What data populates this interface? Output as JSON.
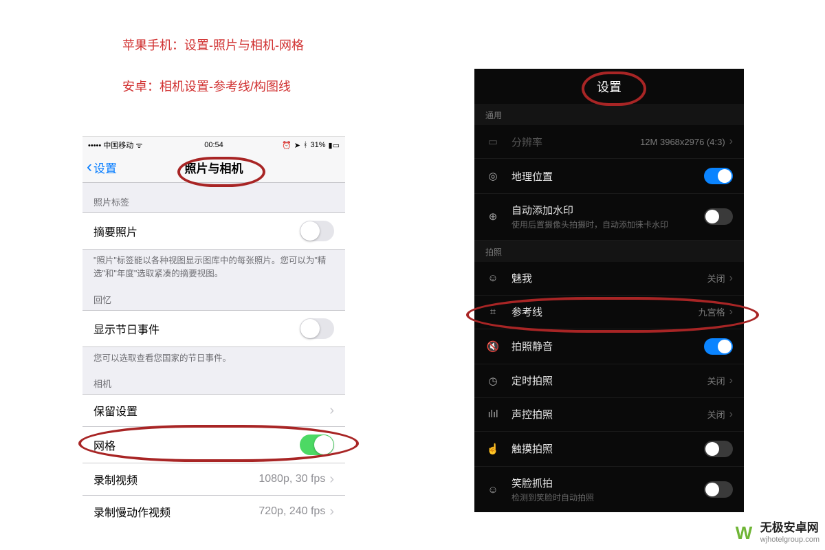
{
  "instructions": {
    "apple": "苹果手机：设置-照片与相机-网格",
    "android": "安卓：相机设置-参考线/构图线"
  },
  "ios": {
    "carrier": "中国移动",
    "time": "00:54",
    "battery": "31%",
    "back": "设置",
    "title": "照片与相机",
    "section_photos": "照片标签",
    "row_summary": "摘要照片",
    "summary_footer": "\"照片\"标签能以各种视图显示图库中的每张照片。您可以为\"精选\"和\"年度\"选取紧凑的摘要视图。",
    "section_memories": "回忆",
    "row_holiday": "显示节日事件",
    "holiday_footer": "您可以选取查看您国家的节日事件。",
    "section_camera": "相机",
    "row_keep": "保留设置",
    "row_grid": "网格",
    "row_video": "录制视频",
    "row_video_val": "1080p, 30 fps",
    "row_slomo": "录制慢动作视频",
    "row_slomo_val": "720p, 240 fps"
  },
  "android": {
    "title": "设置",
    "section_general": "通用",
    "row_resolution": "分辨率",
    "row_resolution_val": "12M 3968x2976 (4:3)",
    "row_geo": "地理位置",
    "row_watermark": "自动添加水印",
    "row_watermark_sub": "使用后置摄像头拍摄时，自动添加徕卡水印",
    "section_shoot": "拍照",
    "row_meiwo": "魅我",
    "val_close": "关闭",
    "row_refline": "参考线",
    "row_refline_val": "九宫格",
    "row_mute": "拍照静音",
    "row_timer": "定时拍照",
    "row_voice": "声控拍照",
    "row_touch": "触摸拍照",
    "row_smile": "笑脸抓拍",
    "row_smile_sub": "检测到笑脸时自动拍照"
  },
  "watermark": {
    "name": "无极安卓网",
    "url": "wjhotelgroup.com"
  }
}
